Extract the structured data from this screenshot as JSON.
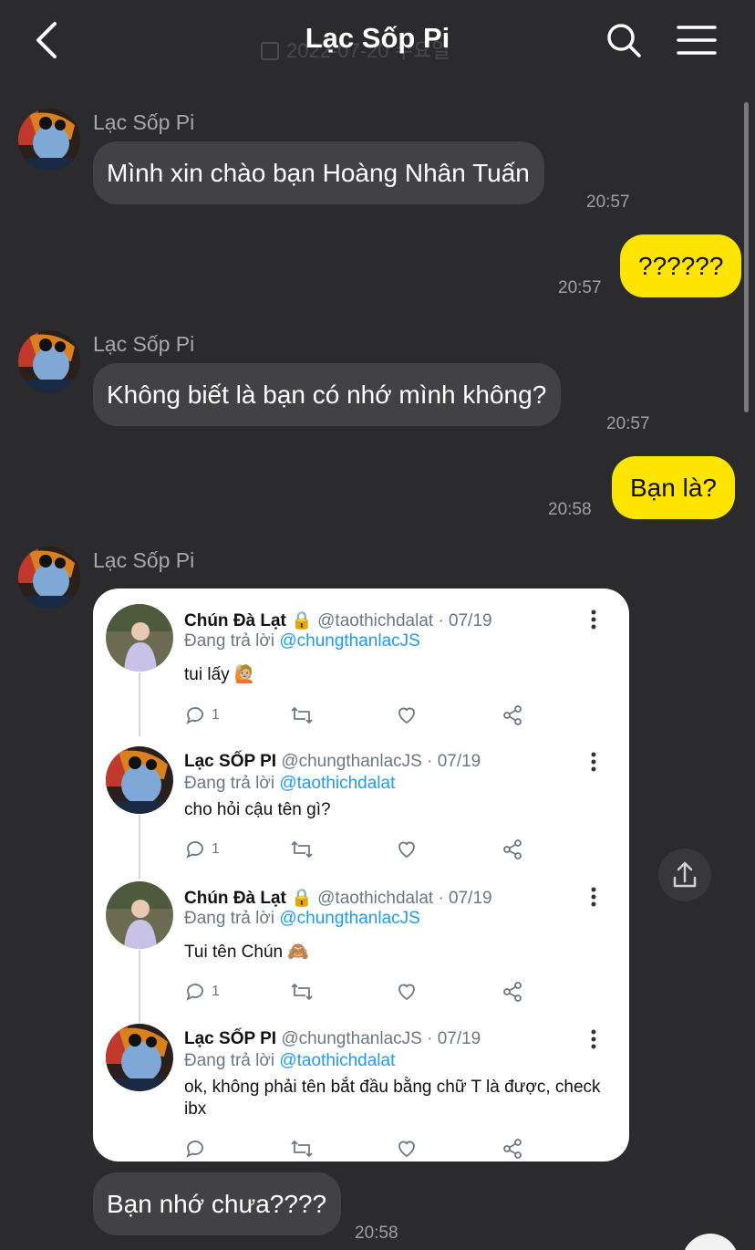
{
  "header": {
    "title": "Lạc Sốp Pi",
    "date_ghost": "2022-07-20 수요일"
  },
  "messages": [
    {
      "sender": "Lạc Sốp Pi",
      "text": "Mình xin chào bạn Hoàng Nhân Tuấn",
      "time": "20:57"
    },
    {
      "text": "??????",
      "time": "20:57"
    },
    {
      "sender": "Lạc Sốp Pi",
      "text": "Không biết là bạn có nhớ mình không?",
      "time": "20:57"
    },
    {
      "text": "Bạn là?",
      "time": "20:58"
    },
    {
      "sender": "Lạc Sốp Pi"
    },
    {
      "text": "Bạn nhớ chưa????",
      "time": "20:58"
    }
  ],
  "tweets": [
    {
      "name": "Chún Đà Lạt",
      "locked": true,
      "handle": "@taothichdalat · 07/19",
      "reply_prefix": "Đang trả lời ",
      "reply_to": "@chungthanlacJS",
      "text": "tui lấy 🙋🏼",
      "replies": "1"
    },
    {
      "name": "Lạc SỐP PI",
      "locked": false,
      "handle": "@chungthanlacJS · 07/19",
      "reply_prefix": "Đang trả lời ",
      "reply_to": "@taothichdalat",
      "text": "cho hỏi cậu tên gì?",
      "replies": "1"
    },
    {
      "name": "Chún Đà Lạt",
      "locked": true,
      "handle": "@taothichdalat · 07/19",
      "reply_prefix": "Đang trả lời ",
      "reply_to": "@chungthanlacJS",
      "text": "Tui tên Chún 🙈",
      "replies": "1"
    },
    {
      "name": "Lạc SỐP PI",
      "locked": false,
      "handle": "@chungthanlacJS · 07/19",
      "reply_prefix": "Đang trả lời ",
      "reply_to": "@taothichdalat",
      "text": "ok, không phải tên bắt đầu bằng chữ T là được, check ibx",
      "replies": ""
    }
  ],
  "icons": {
    "back": "chevron-left-icon",
    "search": "search-icon",
    "menu": "hamburger-menu-icon",
    "share": "share-upload-icon"
  },
  "colors": {
    "background": "#2b2b2d",
    "incoming_bubble": "#424245",
    "outgoing_bubble": "#fde500",
    "mention": "#1d9bf0"
  }
}
